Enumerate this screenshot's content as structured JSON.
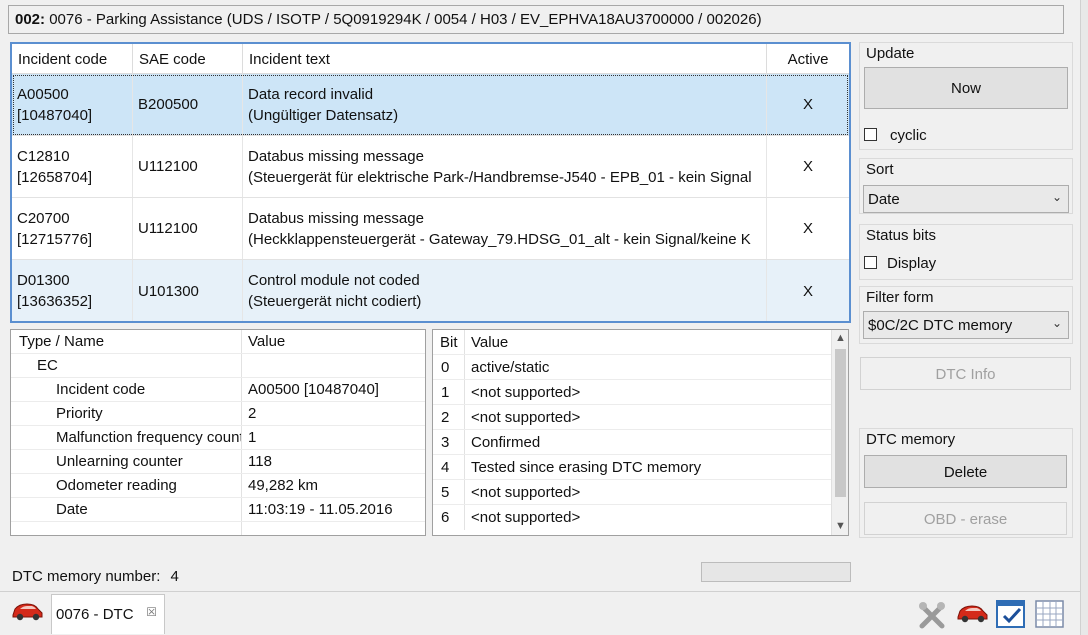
{
  "title": {
    "prefix": "002:",
    "text": " 0076 - Parking Assistance  (UDS / ISOTP / 5Q0919294K  / 0054 / H03 / EV_EPHVA18AU3700000 / 002026)"
  },
  "incident_table": {
    "headers": [
      "Incident code",
      "SAE code",
      "Incident text",
      "Active"
    ],
    "rows": [
      {
        "code": "A00500",
        "code2": "[10487040]",
        "sae": "B200500",
        "text1": "Data record invalid",
        "text2": "(Ungültiger Datensatz)",
        "active": "X"
      },
      {
        "code": "C12810",
        "code2": "[12658704]",
        "sae": "U112100",
        "text1": "Databus missing message",
        "text2": "(Steuergerät für elektrische Park-/Handbremse-J540 - EPB_01 - kein Signal",
        "active": "X"
      },
      {
        "code": "C20700",
        "code2": "[12715776]",
        "sae": "U112100",
        "text1": "Databus missing message",
        "text2": "(Heckklappensteuergerät - Gateway_79.HDSG_01_alt - kein Signal/keine K",
        "active": "X"
      },
      {
        "code": "D01300",
        "code2": "[13636352]",
        "sae": "U101300",
        "text1": "Control module not coded",
        "text2": "(Steuergerät nicht codiert)",
        "active": "X"
      }
    ]
  },
  "detail_table": {
    "headers": [
      "Type / Name",
      "Value"
    ],
    "group": "EC",
    "rows": [
      {
        "name": "Incident code",
        "value": "A00500 [10487040]"
      },
      {
        "name": "Priority",
        "value": "2"
      },
      {
        "name": "Malfunction frequency counter",
        "value": "1"
      },
      {
        "name": "Unlearning counter",
        "value": "118"
      },
      {
        "name": "Odometer reading",
        "value": "49,282 km"
      },
      {
        "name": "Date",
        "value": "11:03:19 - 11.05.2016"
      }
    ]
  },
  "bit_table": {
    "headers": [
      "Bit",
      "Value"
    ],
    "rows": [
      {
        "bit": "0",
        "value": "active/static"
      },
      {
        "bit": "1",
        "value": "<not supported>"
      },
      {
        "bit": "2",
        "value": "<not supported>"
      },
      {
        "bit": "3",
        "value": "Confirmed"
      },
      {
        "bit": "4",
        "value": "Tested since erasing DTC memory"
      },
      {
        "bit": "5",
        "value": "<not supported>"
      },
      {
        "bit": "6",
        "value": "<not supported>"
      }
    ]
  },
  "right_panel": {
    "update_label": "Update",
    "now_button": "Now",
    "cyclic_label": "cyclic",
    "sort_label": "Sort",
    "sort_value": "Date",
    "status_bits_label": "Status bits",
    "display_label": "Display",
    "filter_label": "Filter form",
    "filter_value": "$0C/2C DTC memory",
    "dtc_info_button": "DTC Info",
    "dtc_memory_label": "DTC memory",
    "delete_button": "Delete",
    "obd_erase_button": "OBD - erase"
  },
  "status": {
    "memory_number_label": "DTC memory number:",
    "memory_number_value": "4"
  },
  "tabbar": {
    "active_tab": "0076 - DTC",
    "close_glyph": "☒"
  },
  "icons": {
    "car_color": "#d42a1a",
    "accent": "#5b8fd0"
  }
}
